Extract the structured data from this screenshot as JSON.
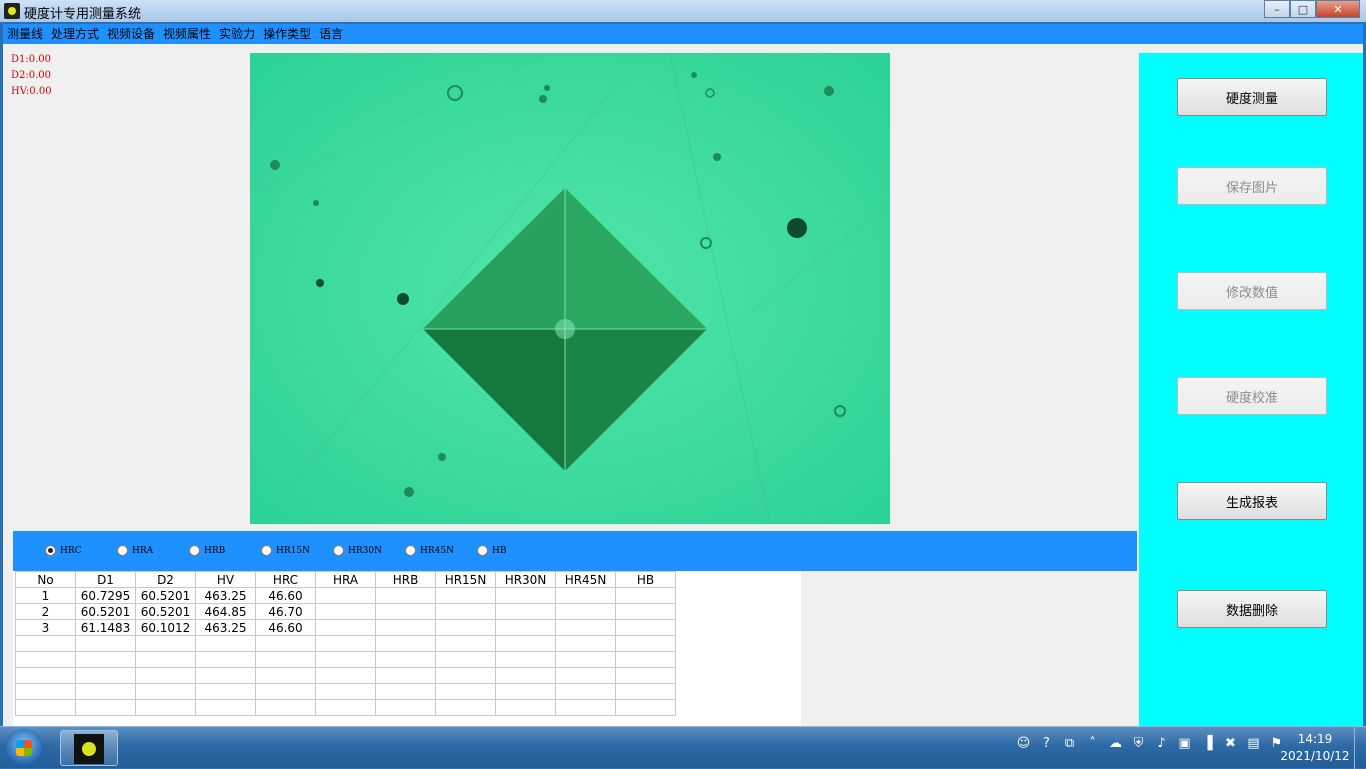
{
  "window": {
    "title": "硬度计专用测量系统"
  },
  "menu": [
    "测量线",
    "处理方式",
    "视频设备",
    "视频属性",
    "实验力",
    "操作类型",
    "语言"
  ],
  "readouts": {
    "d1": "D1:0.00",
    "d2": "D2:0.00",
    "hv": "HV:0.00"
  },
  "scales": {
    "options": [
      "HRC",
      "HRA",
      "HRB",
      "HR15N",
      "HR30N",
      "HR45N",
      "HB"
    ],
    "selected": "HRC"
  },
  "table": {
    "columns": [
      "No",
      "D1",
      "D2",
      "HV",
      "HRC",
      "HRA",
      "HRB",
      "HR15N",
      "HR30N",
      "HR45N",
      "HB"
    ],
    "rows": [
      [
        "1",
        "60.7295",
        "60.5201",
        "463.25",
        "46.60",
        "",
        "",
        "",
        "",
        "",
        ""
      ],
      [
        "2",
        "60.5201",
        "60.5201",
        "464.85",
        "46.70",
        "",
        "",
        "",
        "",
        "",
        ""
      ],
      [
        "3",
        "61.1483",
        "60.1012",
        "463.25",
        "46.60",
        "",
        "",
        "",
        "",
        "",
        ""
      ],
      [
        "",
        "",
        "",
        "",
        "",
        "",
        "",
        "",
        "",
        "",
        ""
      ],
      [
        "",
        "",
        "",
        "",
        "",
        "",
        "",
        "",
        "",
        "",
        ""
      ],
      [
        "",
        "",
        "",
        "",
        "",
        "",
        "",
        "",
        "",
        "",
        ""
      ],
      [
        "",
        "",
        "",
        "",
        "",
        "",
        "",
        "",
        "",
        "",
        ""
      ],
      [
        "",
        "",
        "",
        "",
        "",
        "",
        "",
        "",
        "",
        "",
        ""
      ]
    ]
  },
  "buttons": {
    "measure": "硬度测量",
    "save_image": "保存图片",
    "modify_value": "修改数值",
    "calibrate": "硬度校准",
    "report": "生成报表",
    "delete_data": "数据删除"
  },
  "taskbar": {
    "time": "14:19",
    "date": "2021/10/12",
    "tray_icons": [
      "user-icon",
      "help-icon",
      "network-alt-icon",
      "chevron-up-icon",
      "wechat-icon",
      "shield-icon",
      "volume-icon",
      "monitor-icon",
      "signal-icon",
      "speaker-muted-icon",
      "computer-icon",
      "flag-icon"
    ]
  },
  "colors": {
    "menu_bar": "#1e90ff",
    "side_panel": "#00ffff",
    "camera_view": "#33d99a",
    "readout_text": "#d00000"
  }
}
